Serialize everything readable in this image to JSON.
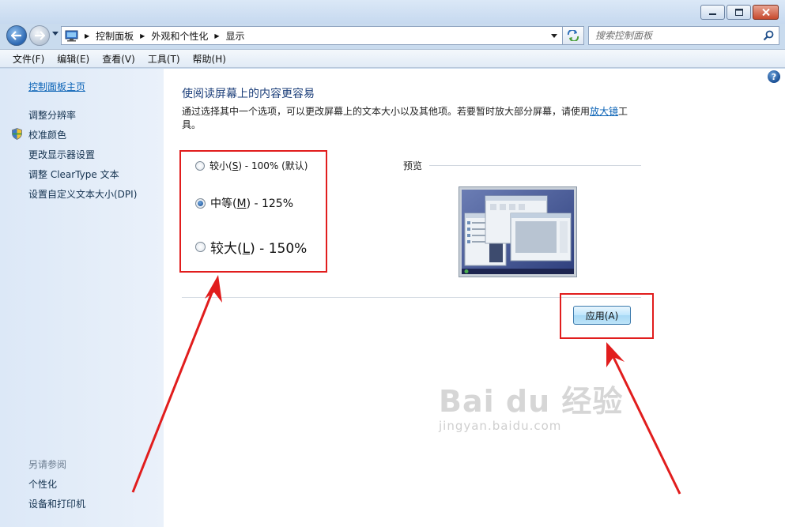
{
  "window": {
    "minimize_glyph": "minimize-icon",
    "maximize_glyph": "maximize-icon",
    "close_glyph": "close-icon"
  },
  "address": {
    "crumbs": [
      "控制面板",
      "外观和个性化",
      "显示"
    ]
  },
  "search": {
    "placeholder": "搜索控制面板"
  },
  "menu": {
    "items": [
      "文件(F)",
      "编辑(E)",
      "查看(V)",
      "工具(T)",
      "帮助(H)"
    ]
  },
  "sidebar": {
    "home": "控制面板主页",
    "items": [
      "调整分辨率",
      "校准颜色",
      "更改显示器设置",
      "调整 ClearType 文本",
      "设置自定义文本大小(DPI)"
    ],
    "see_also_title": "另请参阅",
    "see_also": [
      "个性化",
      "设备和打印机"
    ]
  },
  "main": {
    "heading": "使阅读屏幕上的内容更容易",
    "desc_before": "通过选择其中一个选项，可以更改屏幕上的文本大小以及其他项。若要暂时放大部分屏幕，请使用",
    "desc_link": "放大镜",
    "desc_after": "工具。",
    "options": [
      {
        "pre": "较小(",
        "key": "S",
        "post": ") - 100% (默认)",
        "selected": false
      },
      {
        "pre": "中等(",
        "key": "M",
        "post": ") - 125%",
        "selected": true
      },
      {
        "pre": "较大(",
        "key": "L",
        "post": ") - 150%",
        "selected": false
      }
    ],
    "preview_label": "预览",
    "apply_label": "应用(A)",
    "help_glyph": "?"
  },
  "watermark": {
    "main": "Bai du 经验",
    "sub": "jingyan.baidu.com"
  },
  "colors": {
    "highlight": "#e11d1d",
    "link": "#0b63b6",
    "heading": "#1c3f7a"
  }
}
